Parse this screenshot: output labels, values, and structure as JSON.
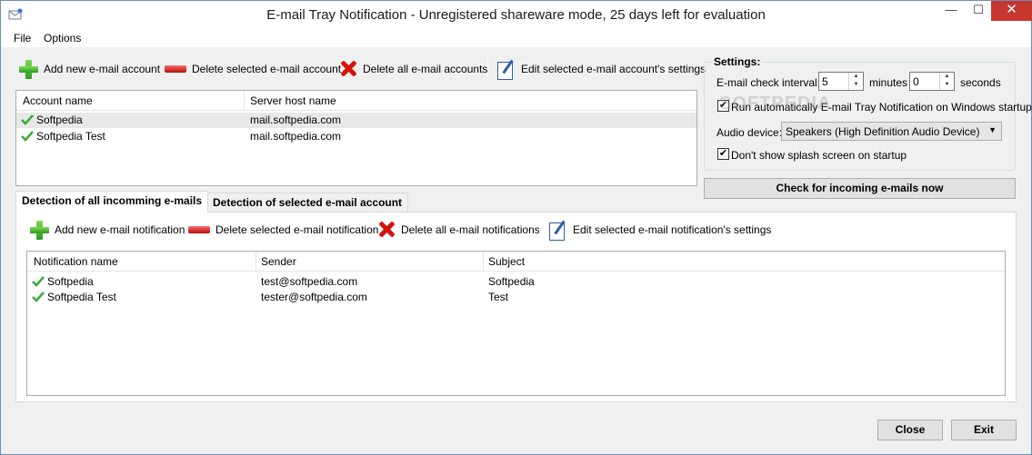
{
  "window": {
    "title": "E-mail Tray Notification - Unregistered shareware mode, 25 days left for evaluation",
    "minimize_glyph": "—",
    "maximize_glyph": "☐",
    "close_glyph": "✕"
  },
  "menu": {
    "file": "File",
    "options": "Options"
  },
  "accounts_toolbar": {
    "add": "Add new e-mail account",
    "delete": "Delete selected e-mail account",
    "delete_all": "Delete all e-mail accounts",
    "edit": "Edit selected e-mail account's settings"
  },
  "accounts_list": {
    "columns": [
      "Account name",
      "Server host name"
    ],
    "rows": [
      {
        "name": "Softpedia",
        "host": "mail.softpedia.com"
      },
      {
        "name": "Softpedia Test",
        "host": "mail.softpedia.com"
      }
    ]
  },
  "settings": {
    "title": "Settings:",
    "interval_label": "E-mail check interval:",
    "minutes_value": "5",
    "minutes_label": "minutes",
    "seconds_value": "0",
    "seconds_label": "seconds",
    "run_on_startup_label": "Run automatically E-mail Tray Notification on Windows startup",
    "run_on_startup_checked": true,
    "audio_label": "Audio device:",
    "audio_value": "Speakers (High Definition Audio Device)",
    "no_splash_label": "Don't show splash screen on startup",
    "no_splash_checked": true,
    "check_mark": "✔"
  },
  "check_now_button": "Check for incoming e-mails now",
  "tabs": {
    "all": "Detection of all incomming e-mails",
    "selected": "Detection of selected e-mail account"
  },
  "notifications_toolbar": {
    "add": "Add new e-mail notification",
    "delete": "Delete selected e-mail notification",
    "delete_all": "Delete all e-mail notifications",
    "edit": "Edit selected e-mail notification's settings"
  },
  "notifications_list": {
    "columns": [
      "Notification name",
      "Sender",
      "Subject"
    ],
    "rows": [
      {
        "name": "Softpedia",
        "sender": "test@softpedia.com",
        "subject": "Softpedia"
      },
      {
        "name": "Softpedia Test",
        "sender": "tester@softpedia.com",
        "subject": "Test"
      }
    ]
  },
  "footer": {
    "close": "Close",
    "exit": "Exit"
  },
  "watermark": "SOFTPEDIA",
  "colors": {
    "accent_close": "#c7372f",
    "check_green": "#3aa93a"
  }
}
